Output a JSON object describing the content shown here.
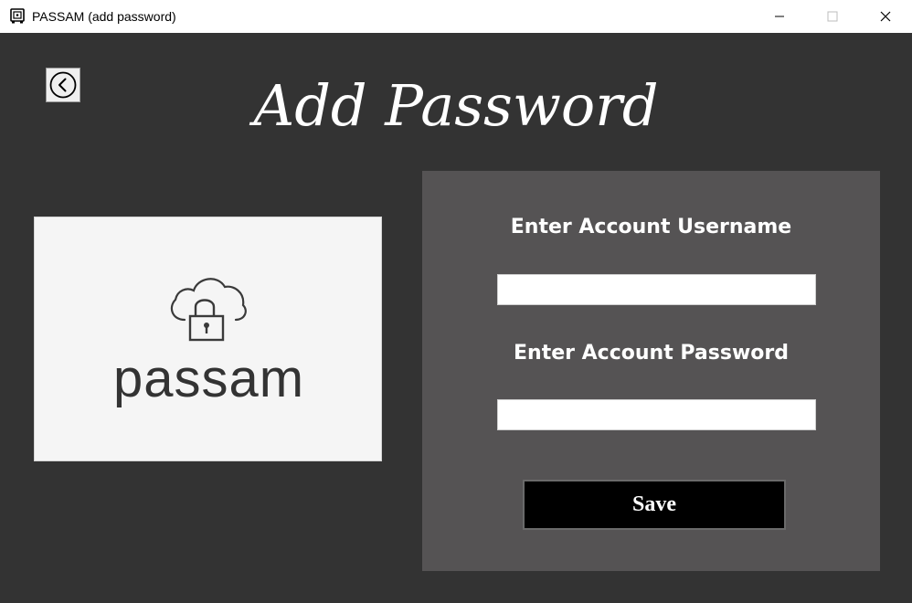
{
  "window": {
    "title": "PASSAM (add password)",
    "app_icon": "vault-icon",
    "controls": {
      "minimize_icon": "minimize-icon",
      "maximize_icon": "maximize-icon",
      "close_icon": "close-icon"
    }
  },
  "header": {
    "back_icon": "chevron-left-circle-icon",
    "title": "Add Password"
  },
  "logo": {
    "graphic": "cloud-lock-icon",
    "text": "passam"
  },
  "form": {
    "username_label": "Enter Account Username",
    "username_value": "",
    "password_label": "Enter Account Password",
    "password_value": "",
    "save_label": "Save"
  },
  "colors": {
    "background": "#333333",
    "form_panel": "#555354",
    "logo_panel": "#f5f5f5",
    "save_button": "#000000",
    "text": "#ffffff"
  }
}
